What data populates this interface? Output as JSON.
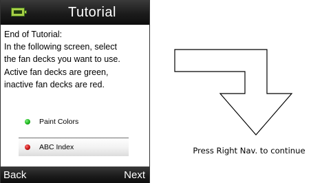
{
  "device": {
    "title": "Tutorial",
    "battery_icon": "battery-icon",
    "body_lines": [
      "End of Tutorial:",
      "In the following screen, select",
      "the fan decks you want to use.",
      "Active fan decks are green,",
      "inactive fan decks are red."
    ],
    "fan_decks": [
      {
        "label": "Paint Colors",
        "status": "active",
        "color": "#1db51d"
      },
      {
        "label": "ABC Index",
        "status": "inactive",
        "color": "#c41414"
      }
    ],
    "softkeys": {
      "left": "Back",
      "right": "Next"
    }
  },
  "annotation": {
    "arrow_icon": "arrow-down-icon",
    "caption": "Press Right Nav. to continue"
  }
}
